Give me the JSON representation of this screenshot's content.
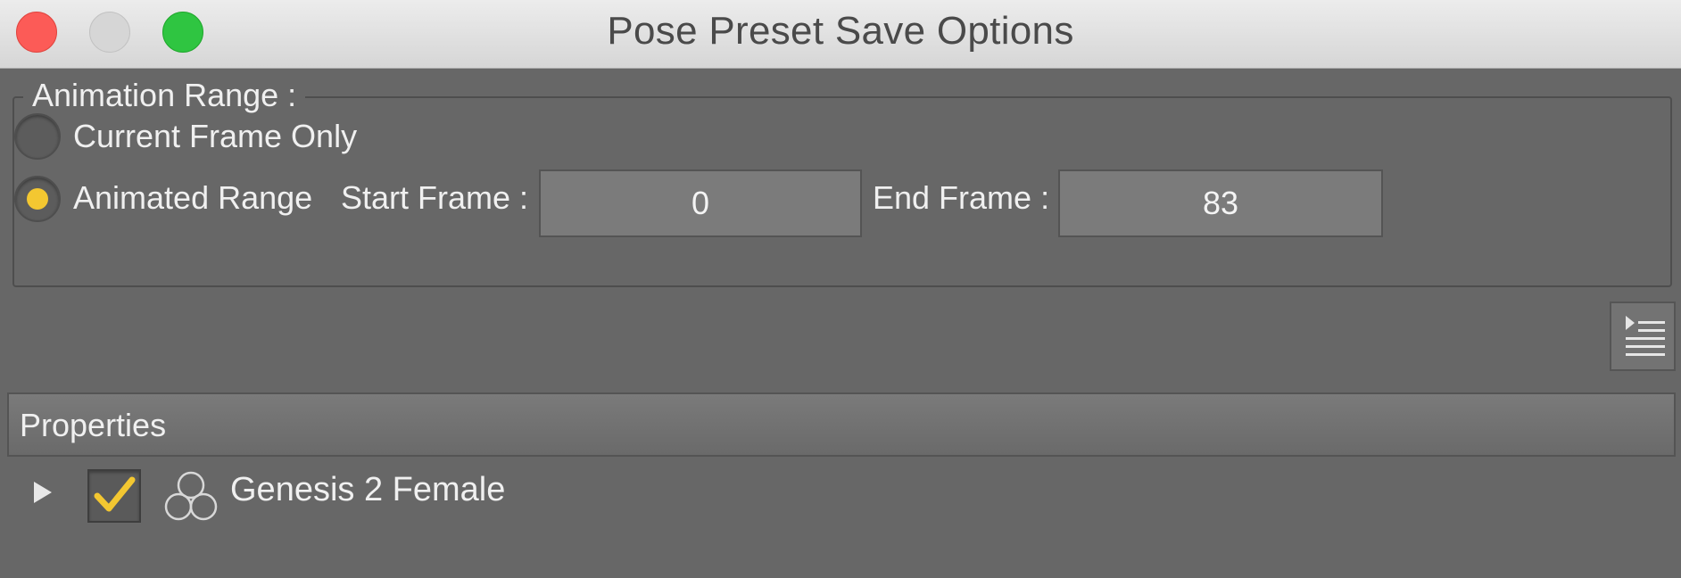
{
  "window": {
    "title": "Pose Preset Save Options"
  },
  "animation_range": {
    "group_label": "Animation Range :",
    "current_frame_label": "Current Frame Only",
    "animated_range_label": "Animated Range",
    "selected_option": "Animated Range",
    "start_frame_label": "Start Frame :",
    "start_frame_value": "0",
    "end_frame_label": "End Frame :",
    "end_frame_value": "83"
  },
  "properties": {
    "header_label": "Properties",
    "items": [
      {
        "label": "Genesis 2 Female",
        "checked": true,
        "icon": "figure-icon",
        "expanded": false
      }
    ]
  },
  "colors": {
    "accent": "#f3c731",
    "panel_bg": "#676767"
  }
}
